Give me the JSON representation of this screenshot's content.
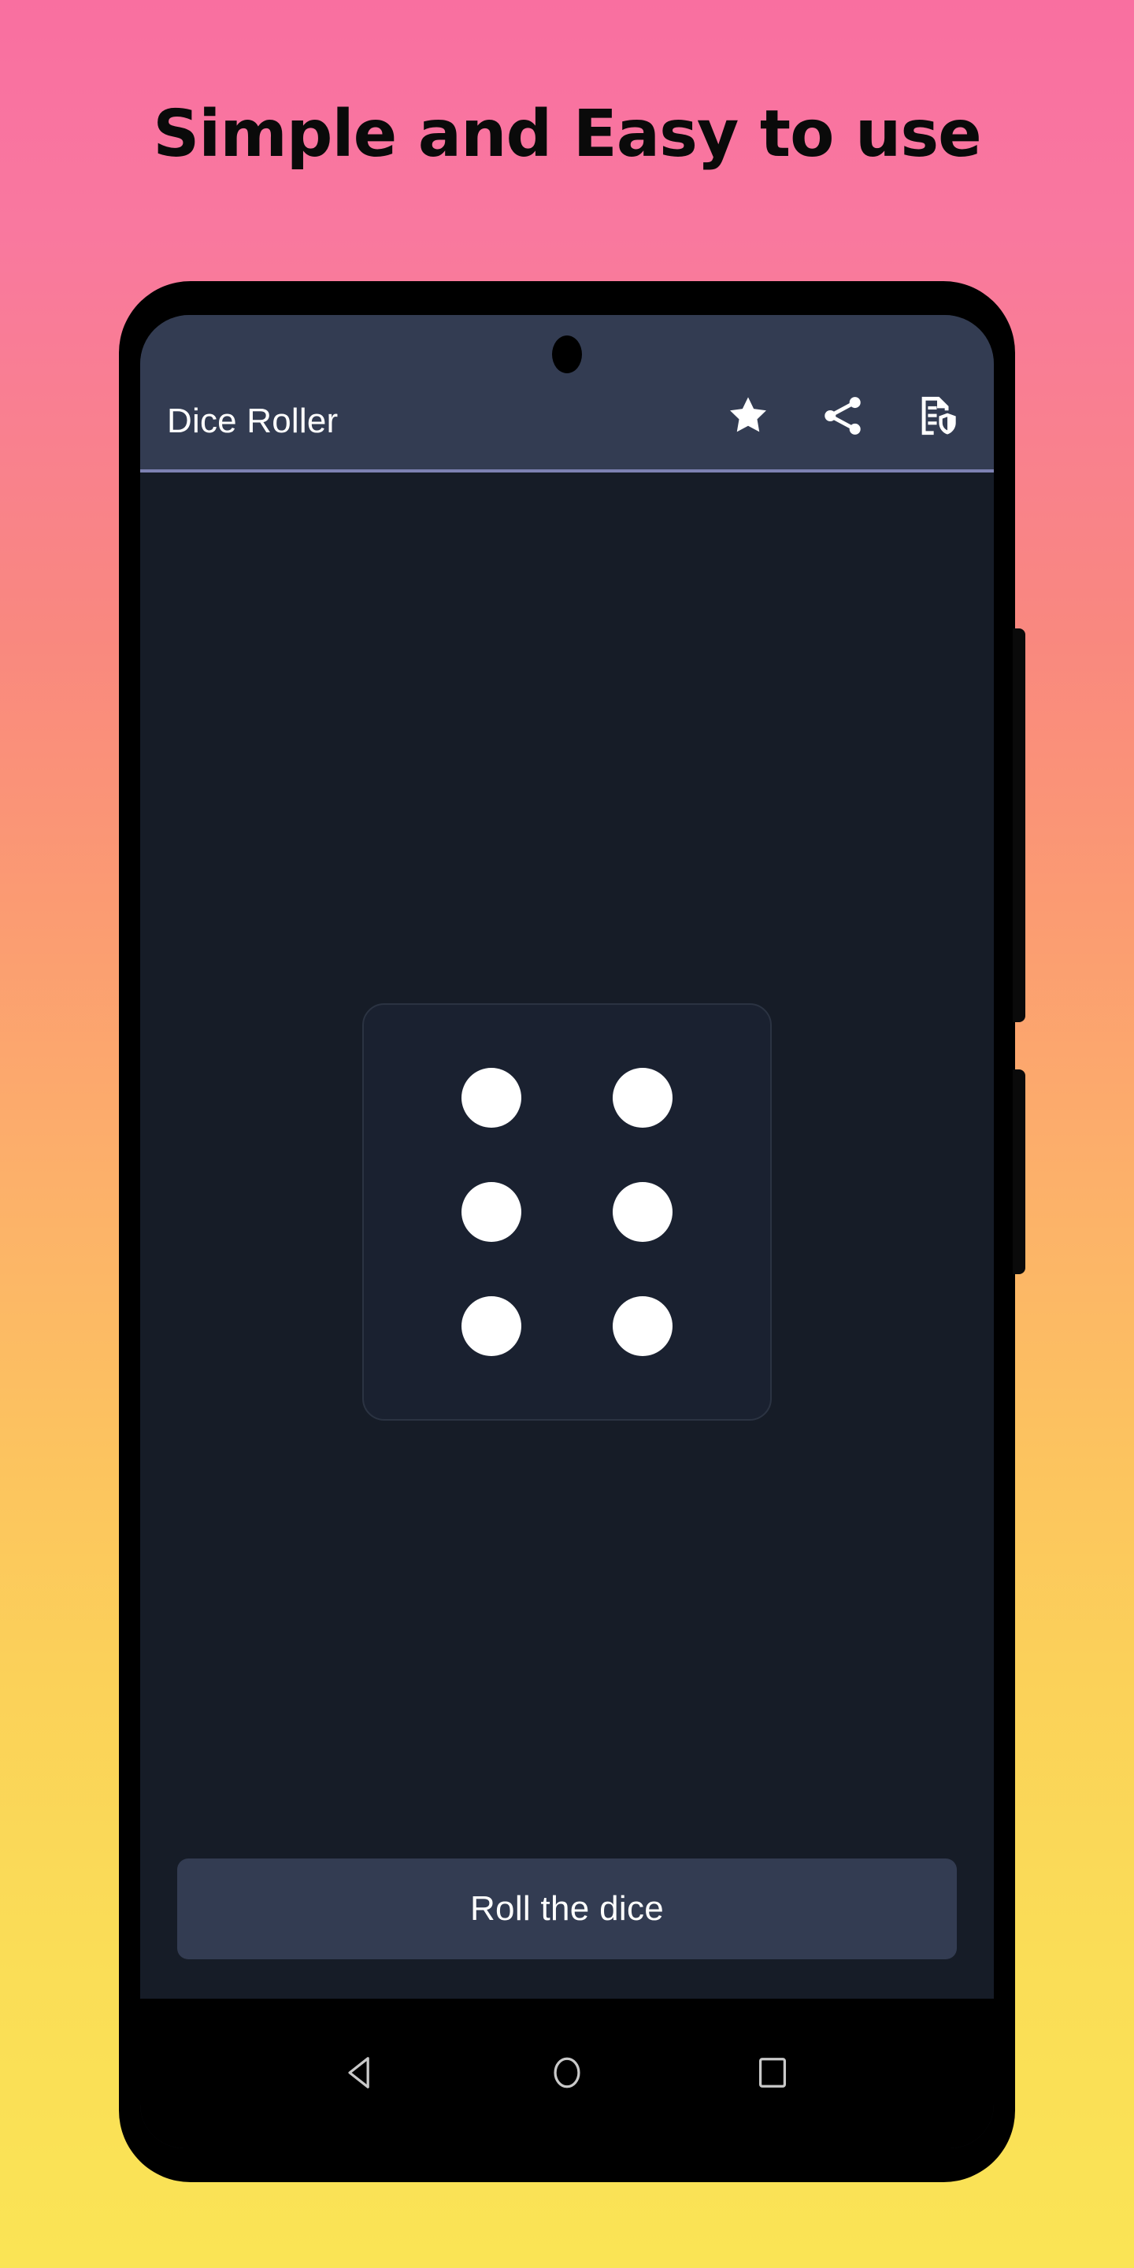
{
  "promo": {
    "headline": "Simple and Easy to use",
    "background_top_color": "#f96fa0",
    "background_bottom_color": "#fae455"
  },
  "app": {
    "appbar": {
      "title": "Dice Roller",
      "background_color": "#333c52",
      "divider_color": "#7d81b2",
      "actions": [
        {
          "name": "star-icon",
          "label": "Rate app"
        },
        {
          "name": "share-icon",
          "label": "Share"
        },
        {
          "name": "privacy-policy-icon",
          "label": "Privacy policy"
        }
      ]
    },
    "content": {
      "background_color": "#161c27",
      "dice": {
        "value": 6,
        "face_label": "6",
        "pip_color": "#ffffff",
        "card_color": "#1a2130",
        "pips": [
          true,
          true,
          true,
          true,
          true,
          true
        ]
      }
    },
    "roll_button": {
      "label": "Roll the dice",
      "background_color": "#333c52",
      "text_color": "#ffffff"
    }
  },
  "system_nav": {
    "background_color": "#000000",
    "buttons": [
      {
        "name": "back-button",
        "label": "Back"
      },
      {
        "name": "home-button",
        "label": "Home"
      },
      {
        "name": "recents-button",
        "label": "Recents"
      }
    ]
  }
}
